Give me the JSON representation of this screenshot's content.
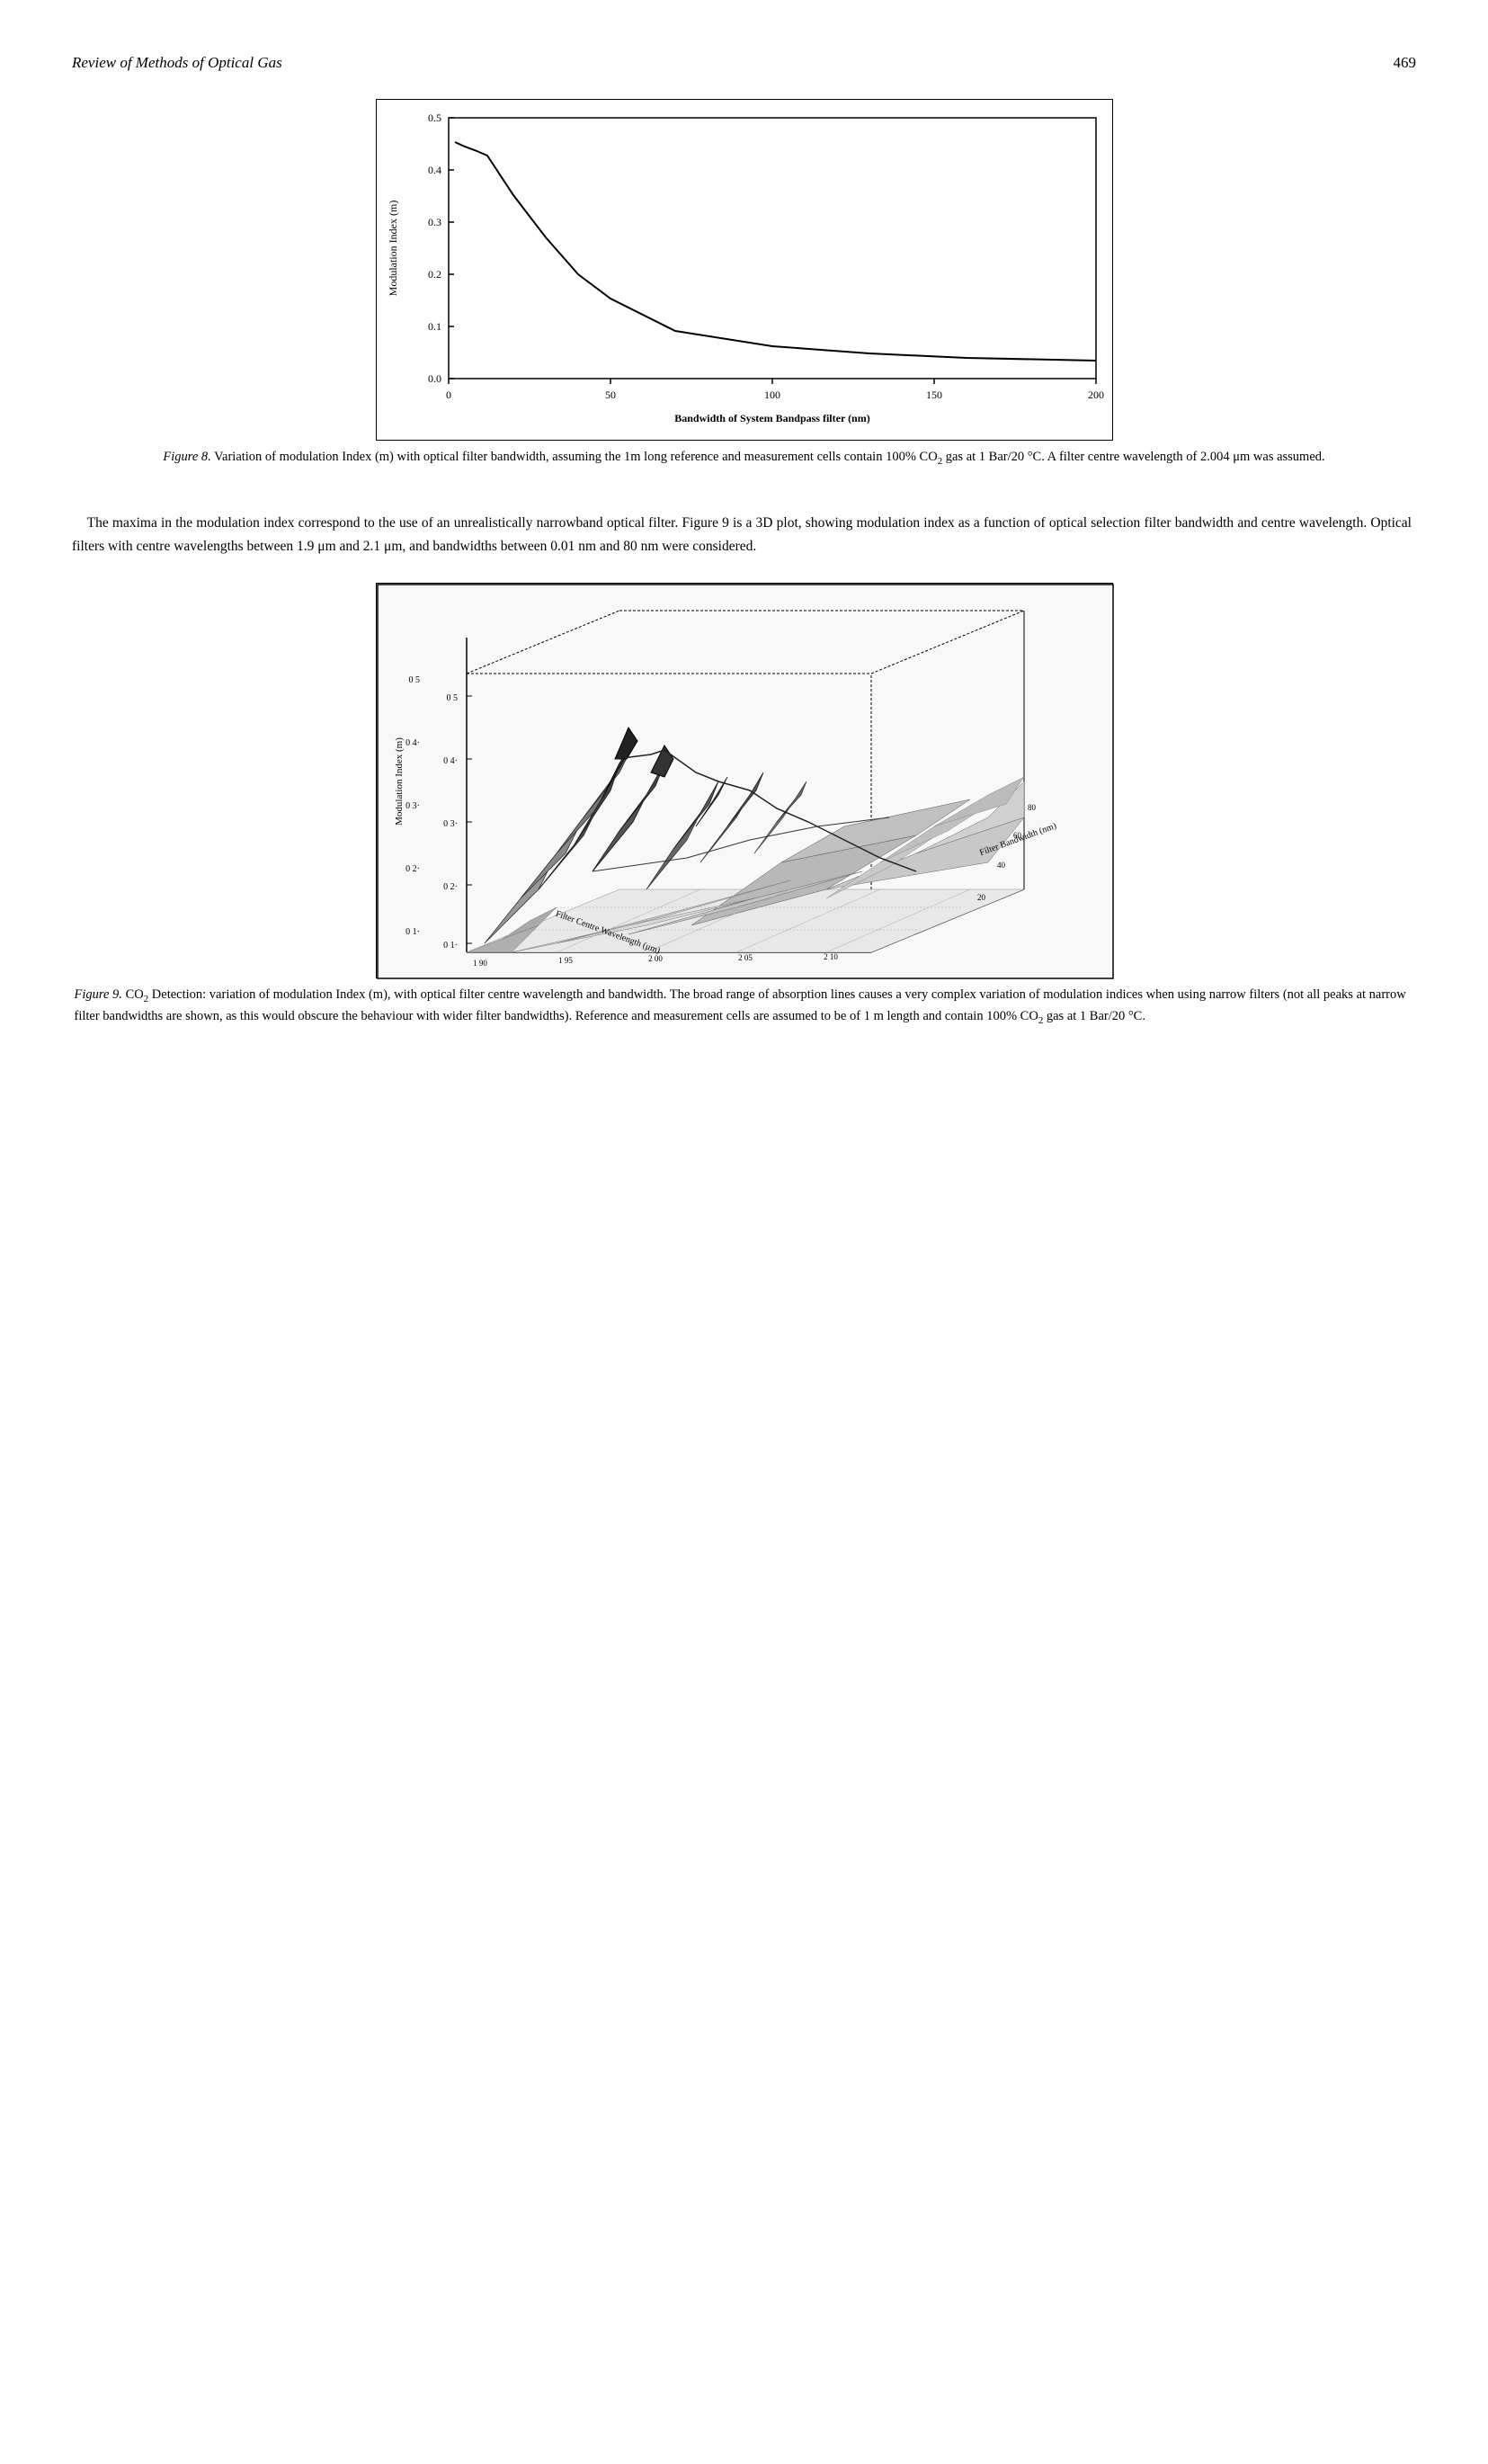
{
  "header": {
    "title": "Review of Methods of Optical Gas",
    "page_number": "469"
  },
  "figure8": {
    "caption_bold": "Figure 8.",
    "caption_text": " Variation of modulation Index (m) with optical filter bandwidth, assuming the 1m long reference and measurement cells contain 100% CO",
    "caption_sub": "2",
    "caption_text2": " gas at 1 Bar/20 °C. A filter centre wavelength of 2.004 μm was assumed.",
    "chart": {
      "y_label": "Modulation Index (m)",
      "x_label": "Bandwidth of System Bandpass filter (nm)",
      "y_ticks": [
        "0.0",
        "0.1",
        "0.2",
        "0.3",
        "0.4",
        "0.5"
      ],
      "x_ticks": [
        "0",
        "50",
        "100",
        "150",
        "200"
      ]
    }
  },
  "body_paragraph": {
    "text": "The maxima in the modulation index correspond to the use of an unrealistically narrowband optical filter. Figure 9 is a 3D plot, showing modulation index as a function of optical selection filter bandwidth and centre wavelength. Optical filters with centre wavelengths between 1.9 μm and 2.1 μm, and bandwidths between 0.01 nm and 80 nm were considered."
  },
  "figure9": {
    "caption_bold": "Figure 9.",
    "caption_text": " CO",
    "caption_sub": "2",
    "caption_text2": " Detection: variation of modulation Index (m), with optical filter centre wavelength and bandwidth. The broad range of absorption lines causes a very complex variation of modulation indices when using narrow filters (not all peaks at narrow filter bandwidths are shown, as this would obscure the behaviour with wider filter bandwidths). Reference and measurement cells are assumed to be of 1 m length and contain 100% CO",
    "caption_sub2": "2",
    "caption_text3": " gas at 1 Bar/20 °C.",
    "chart": {
      "y_label": "Modulation Index (m)",
      "x1_label": "Filter Centre Wavelength (μm)",
      "x2_label": "Filter Bandwidth (nm)",
      "y_ticks": [
        "0 1",
        "0 2",
        "0 3",
        "0 4",
        "0 5"
      ],
      "x1_ticks": [
        "1 90",
        "1 95",
        "2 00",
        "2 05",
        "2 10"
      ],
      "x2_ticks": [
        "20",
        "40",
        "60",
        "80"
      ]
    }
  }
}
